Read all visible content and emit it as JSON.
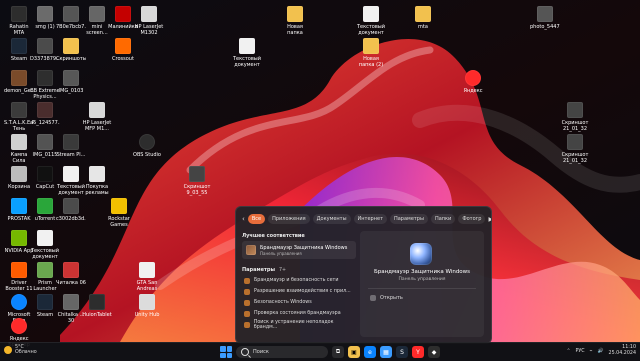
{
  "desktop": {
    "icons": [
      {
        "label": "Rahatin MTA Launcher",
        "name": "icon-rahatin-mta-launcher",
        "color": "#2d2d2d"
      },
      {
        "label": "Steam",
        "name": "icon-steam",
        "color": "#1b2838"
      },
      {
        "label": "demon_Ge...",
        "name": "icon-demon-ge",
        "color": "#7a4b2a"
      },
      {
        "label": "S.T.A.L.K.E.R. Тень Черн...",
        "name": "icon-stalker",
        "color": "#3b3b3b"
      },
      {
        "label": "Кампа Сила",
        "name": "icon-kampa-sila",
        "color": "#d0d0d0"
      },
      {
        "label": "Корзина",
        "name": "icon-recycle-bin",
        "color": "#bcbcbc"
      },
      {
        "label": "PROSTAK",
        "name": "icon-prostak",
        "color": "#0aa0ff"
      },
      {
        "label": "NVIDIA App",
        "name": "icon-nvidia-app",
        "color": "#76b900"
      },
      {
        "label": "Driver Booster 11",
        "name": "icon-driver-booster",
        "color": "#ff5c00"
      },
      {
        "label": "Microsoft Edge",
        "name": "icon-microsoft-edge",
        "color": "#0a84ff"
      },
      {
        "label": "Яндекс Браузер",
        "name": "icon-yandex-browser",
        "color": "#ff2a2a"
      },
      {
        "label": "smg (1)",
        "name": "icon-smg-1",
        "color": "#6b6b6b"
      },
      {
        "label": "D3373879...",
        "name": "icon-d3373879",
        "color": "#4b4b4b"
      },
      {
        "label": "BB Extreme Physics...",
        "name": "icon-bb-extreme-physics",
        "color": "#2e2e2e"
      },
      {
        "label": "a5_124577...",
        "name": "icon-a5-124577",
        "color": "#4a2d2d"
      },
      {
        "label": "IMG_0115",
        "name": "icon-img-0115",
        "color": "#535353"
      },
      {
        "label": "CapCut",
        "name": "icon-capcut",
        "color": "#111111"
      },
      {
        "label": "uTorrent",
        "name": "icon-utorrent",
        "color": "#2aa63a"
      },
      {
        "label": "Текстовый документ",
        "name": "icon-text-document",
        "color": "#f1f1f1"
      },
      {
        "label": "Prism Launcher",
        "name": "icon-prism-launcher",
        "color": "#6aa84f"
      },
      {
        "label": "Steam",
        "name": "icon-steam-2",
        "color": "#1b2838"
      },
      {
        "label": "7B0e7bcb7...",
        "name": "icon-7b0e7bcb7",
        "color": "#555555"
      },
      {
        "label": "Скриншоты",
        "name": "icon-screenshots",
        "color": "#f2c14e"
      },
      {
        "label": "IMG_0103",
        "name": "icon-img-0103",
        "color": "#575757"
      },
      {
        "label": "Stream Pl...",
        "name": "icon-stream-pl",
        "color": "#3a3a3a"
      },
      {
        "label": "Текстовый документ (2)",
        "name": "icon-text-document-2",
        "color": "#f1f1f1"
      },
      {
        "label": "c3002db3d...",
        "name": "icon-c3002db3d",
        "color": "#4b4b4b"
      },
      {
        "label": "Читалка 06",
        "name": "icon-chitalka-06",
        "color": "#c33"
      },
      {
        "label": "Chitalka ... 30",
        "name": "icon-chitalka-30",
        "color": "#666"
      },
      {
        "label": "mini screen...",
        "name": "icon-mini-screen",
        "color": "#666"
      },
      {
        "label": "Crossout",
        "name": "icon-crossout",
        "color": "#ff6a00"
      },
      {
        "label": "HP LaserJet MFP M1...",
        "name": "icon-hp-laserjet",
        "color": "#d8d8d8"
      },
      {
        "label": "Покупка рекламы",
        "name": "icon-purchase-ads",
        "color": "#e6e6e6"
      },
      {
        "label": "Rockstar Games Launcher",
        "name": "icon-rockstar",
        "color": "#f3c000"
      },
      {
        "label": "HuionTablet",
        "name": "icon-huion-tablet",
        "color": "#2d2d2d"
      },
      {
        "label": "Малинийка",
        "name": "icon-malinka",
        "color": "#c40000"
      },
      {
        "label": "HP LaserJet M1302 MFP...",
        "name": "icon-hp-laserjet-2",
        "color": "#d8d8d8"
      },
      {
        "label": "OBS Studio",
        "name": "icon-obs",
        "color": "#2d2d2d"
      },
      {
        "label": "Unity Hub",
        "name": "icon-unity-hub",
        "color": "#dcdcdc"
      },
      {
        "label": "GTA San Andreas",
        "name": "icon-gta-sa",
        "color": "#f1f1f1"
      },
      {
        "label": "Новая папка",
        "name": "icon-new-folder",
        "color": "#f2c14e"
      },
      {
        "label": "Текстовый документ (2)",
        "name": "icon-text-document-3",
        "color": "#f1f1f1"
      },
      {
        "label": "Новая папка (2)",
        "name": "icon-new-folder-2",
        "color": "#f2c14e"
      },
      {
        "label": "Текстовый документ",
        "name": "icon-text-document-4",
        "color": "#f1f1f1"
      },
      {
        "label": "mta",
        "name": "icon-mta",
        "color": "#f2c14e"
      },
      {
        "label": "Яндекс",
        "name": "icon-yandex",
        "color": "#ff2a2a"
      },
      {
        "label": "photo_5447...",
        "name": "icon-photo-5447",
        "color": "#555"
      },
      {
        "label": "Скриншот 21_01_32",
        "name": "icon-screenshot-21-01-32",
        "color": "#444"
      },
      {
        "label": "Скриншот 9_03_55",
        "name": "icon-screenshot-9-03-55",
        "color": "#444"
      },
      {
        "label": "Скриншот 21_01_32 (2)",
        "name": "icon-screenshot-21-01-32-2",
        "color": "#444"
      }
    ]
  },
  "popup": {
    "tabs": [
      "Все",
      "Приложения",
      "Документы",
      "Интернет",
      "Параметры",
      "Папки",
      "Фотогр"
    ],
    "active_tab": "Все",
    "best_match_header": "Лучшее соответствие",
    "best_match_title": "Брандмауэр Защитника Windows",
    "best_match_subtitle": "Панель управления",
    "params_header": "Параметры",
    "params_count": "7+",
    "results": [
      "Брандмауэр и безопасность сети",
      "Разрешение взаимодействия с прил...",
      "Безопасность Windows",
      "Проверка состояния брандмауэра",
      "Поиск и устранение неполадок брандм..."
    ],
    "right": {
      "title": "Брандмауэр Защитника Windows",
      "subtitle": "Панель управления",
      "open_label": "Открыть"
    }
  },
  "taskbar": {
    "weather": {
      "temp": "5°C",
      "cond": "Облачно"
    },
    "search_placeholder": "Поиск",
    "tray": {
      "lang": "РУС",
      "time": "11:10",
      "date": "25.04.2024"
    }
  }
}
